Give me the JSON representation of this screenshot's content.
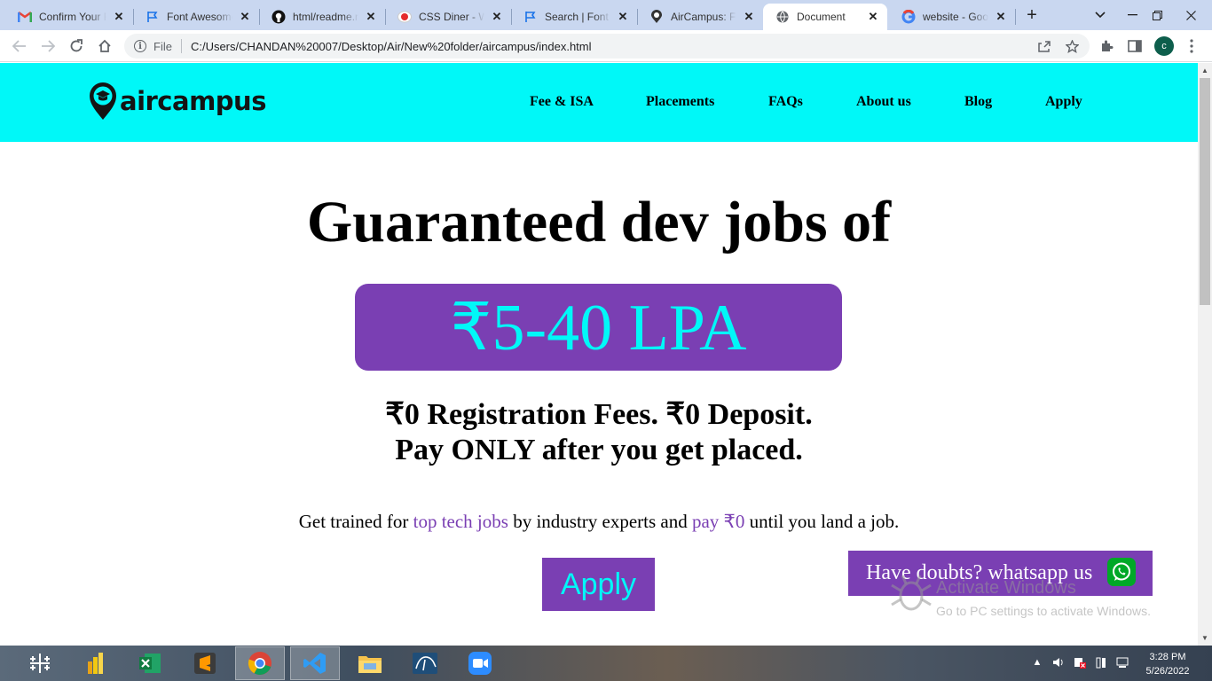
{
  "browser": {
    "tabs": [
      {
        "title": "Confirm Your F",
        "icon": "gmail-icon"
      },
      {
        "title": "Font Awesome",
        "icon": "flag-icon"
      },
      {
        "title": "html/readme.m",
        "icon": "github-icon"
      },
      {
        "title": "CSS Diner - Wh",
        "icon": "red-dot-icon"
      },
      {
        "title": "Search | Font A",
        "icon": "flag-icon"
      },
      {
        "title": "AirCampus: Fu",
        "icon": "location-pin-icon"
      },
      {
        "title": "Document",
        "icon": "globe-icon"
      },
      {
        "title": "website - Goog",
        "icon": "google-icon"
      }
    ],
    "address": {
      "scheme_label": "File",
      "url": "C:/Users/CHANDAN%20007/Desktop/Air/New%20folder/aircampus/index.html"
    },
    "profile_initial": "c"
  },
  "site": {
    "logo_text": "aircampus",
    "nav": [
      "Fee & ISA",
      "Placements",
      "FAQs",
      "About us",
      "Blog",
      "Apply"
    ],
    "hero": {
      "title": "Guaranteed dev jobs of",
      "salary": "₹5-40 LPA",
      "line1": "₹0 Registration Fees. ₹0 Deposit.",
      "line2": "Pay ONLY after you get placed.",
      "desc_1": "Get trained for ",
      "desc_hl1": "top tech jobs",
      "desc_2": " by industry experts and ",
      "desc_hl2": "pay ₹0",
      "desc_3": " until you land a job.",
      "apply_label": "Apply"
    },
    "whatsapp_label": "Have doubts? whatsapp us",
    "colors": {
      "header_bg": "#00f8f8",
      "accent": "#7a3fb3",
      "accent_text": "#00f8f8"
    }
  },
  "os": {
    "watermark_title": "Activate Windows",
    "watermark_sub": "Go to PC settings to activate Windows.",
    "clock_time": "3:28 PM",
    "clock_date": "5/26/2022",
    "taskbar_apps": [
      "tableau-icon",
      "power-bi-icon",
      "excel-icon",
      "sublime-icon",
      "chrome-icon",
      "vscode-icon",
      "file-explorer-icon",
      "mysql-icon",
      "zoom-icon"
    ]
  }
}
